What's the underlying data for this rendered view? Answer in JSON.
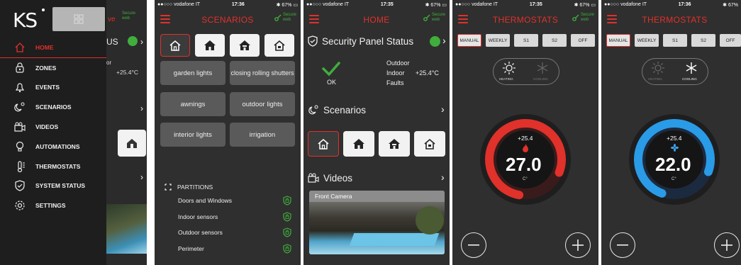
{
  "menu": {
    "logo": "KS",
    "items": [
      {
        "label": "HOME",
        "icon": "home-icon"
      },
      {
        "label": "ZONES",
        "icon": "zones-icon"
      },
      {
        "label": "EVENTS",
        "icon": "bell-icon"
      },
      {
        "label": "SCENARIOS",
        "icon": "scenarios-icon"
      },
      {
        "label": "VIDEOS",
        "icon": "camera-icon"
      },
      {
        "label": "AUTOMATIONS",
        "icon": "bulb-icon"
      },
      {
        "label": "THERMOSTATS",
        "icon": "thermometer-icon"
      },
      {
        "label": "SYSTEM STATUS",
        "icon": "shield-icon"
      },
      {
        "label": "SETTINGS",
        "icon": "gear-icon"
      }
    ],
    "behind_fragment_title": "ve",
    "behind_fragment_status": "US",
    "behind_fragment_or": "or",
    "behind_fragment_temp": "+25.4°C"
  },
  "status_bar": {
    "carrier": "●●○○○ vodafone IT",
    "time_scenarios": "17:36",
    "time_home": "17:35",
    "time_thermo_heat": "17:35",
    "time_thermo_cool": "17:36",
    "battery": "67%"
  },
  "secure_web": {
    "line1": "Secure",
    "line2": "web"
  },
  "scenarios_screen": {
    "title": "SCENARIOS",
    "pills": [
      "garden lights",
      "closing rolling shutters",
      "awnings",
      "outdoor lights",
      "interior lights",
      "irrigation"
    ],
    "partitions_header": "PARTITIONS",
    "partitions": [
      "Doors and Windows",
      "Indoor sensors",
      "Outdoor sensors",
      "Perimeter"
    ]
  },
  "home_screen": {
    "title": "HOME",
    "security_title": "Security Panel Status",
    "ok_label": "OK",
    "outdoor_label": "Outdoor",
    "indoor_label": "Indoor",
    "faults_label": "Faults",
    "indoor_temp": "+25.4°C",
    "scenarios_title": "Scenarios",
    "videos_title": "Videos",
    "camera_label": "Front Camera"
  },
  "thermo_heat": {
    "title": "THERMOSTATS",
    "modes": [
      "MANUAL",
      "WEEKLY",
      "S1",
      "S2",
      "OFF"
    ],
    "heating_label": "HEATING",
    "cooling_label": "COOLING",
    "current_temp": "+25.4",
    "setpoint": "27.0",
    "unit": "C°",
    "accent": "#e0312b"
  },
  "thermo_cool": {
    "title": "THERMOSTATS",
    "modes": [
      "MANUAL",
      "WEEKLY",
      "S1",
      "S2",
      "OFF"
    ],
    "heating_label": "HEATING",
    "cooling_label": "COOLING",
    "current_temp": "+25.4",
    "setpoint": "22.0",
    "unit": "C°",
    "accent": "#1f8de0"
  }
}
